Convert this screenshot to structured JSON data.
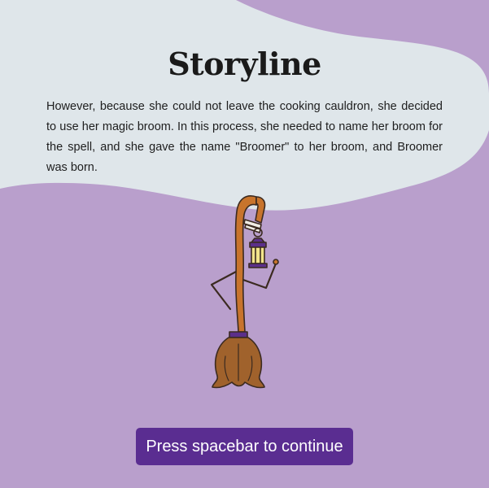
{
  "story": {
    "title": "Storyline",
    "text": "However, because she could not leave the cooking cauldron, she decided to use her magic broom. In this process, she needed to name her broom for the spell, and she gave the name \"Broomer\" to her broom, and Broomer was born."
  },
  "continue_button": {
    "label": "Press spacebar to continue"
  },
  "colors": {
    "background": "#b99fcc",
    "panel": "#dfe6ea",
    "button": "#5a2d91",
    "broom_handle": "#c8742c",
    "bristles": "#a0622c",
    "lantern": "#5b2f8a"
  },
  "icons": {
    "character": "broom-character-icon"
  }
}
